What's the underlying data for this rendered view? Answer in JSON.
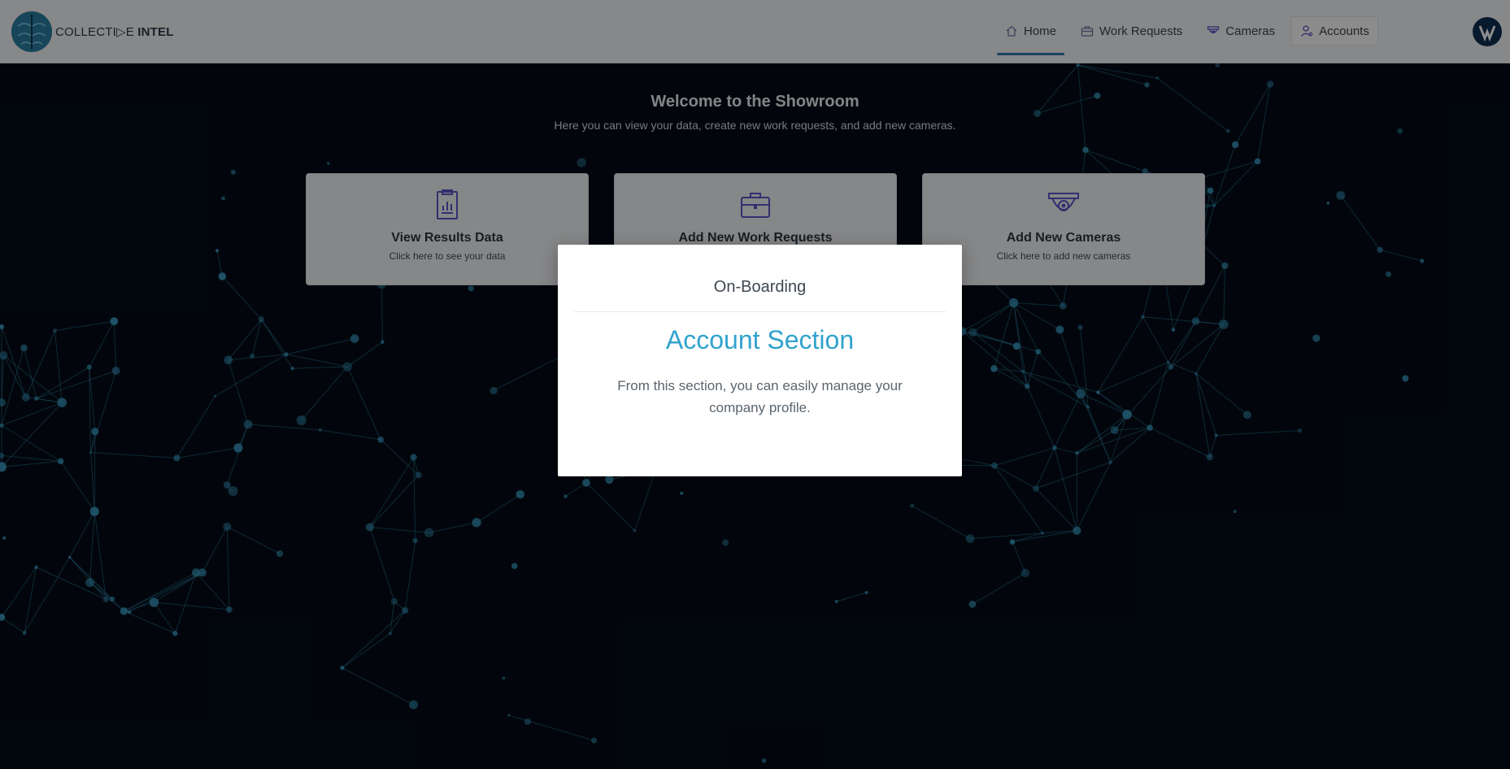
{
  "header": {
    "logo_text_prefix": "COLLECTI▷E",
    "logo_text_suffix": "INTEL",
    "nav": [
      {
        "label": "Home",
        "icon": "home-icon"
      },
      {
        "label": "Work Requests",
        "icon": "briefcase-icon"
      },
      {
        "label": "Cameras",
        "icon": "camera-icon"
      },
      {
        "label": "Accounts",
        "icon": "user-icon"
      }
    ],
    "active_nav": "Home",
    "highlighted_nav": "Accounts"
  },
  "welcome": {
    "title": "Welcome to the Showroom",
    "subtitle": "Here you can view your data, create new work requests, and add new cameras."
  },
  "cards": [
    {
      "title": "View Results Data",
      "subtitle": "Click here to see your data",
      "icon": "clipboard-chart-icon"
    },
    {
      "title": "Add New Work Requests",
      "subtitle": "",
      "icon": "briefcase-icon"
    },
    {
      "title": "Add New Cameras",
      "subtitle": "Click here to add new cameras",
      "icon": "security-camera-icon"
    }
  ],
  "modal": {
    "title": "On-Boarding",
    "heading": "Account Section",
    "body": "From this section, you can easily manage your company profile."
  },
  "colors": {
    "accent": "#31a3cc",
    "nav_active": "#2f7ab5",
    "background": "#040c17",
    "icon_purple": "#5b57c9"
  }
}
